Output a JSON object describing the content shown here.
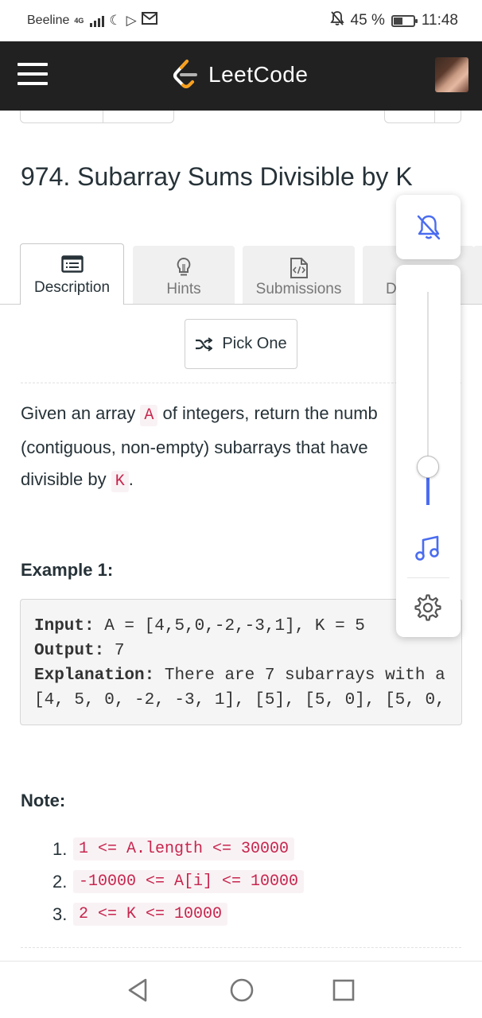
{
  "status_bar": {
    "carrier": "Beeline",
    "network": "4G",
    "battery_percent": "45 %",
    "battery_level": 0.45,
    "time": "11:48"
  },
  "header": {
    "logo_text": "LeetCode",
    "menu_icon": "hamburger-menu-icon"
  },
  "problem": {
    "title": "974. Subarray Sums Divisible by K"
  },
  "tabs": [
    {
      "label": "Description",
      "icon": "description-icon",
      "active": true
    },
    {
      "label": "Hints",
      "icon": "lightbulb-icon",
      "active": false
    },
    {
      "label": "Submissions",
      "icon": "code-file-icon",
      "active": false
    },
    {
      "label": "D",
      "icon": "discuss-icon",
      "active": false
    }
  ],
  "pick_one": {
    "label": "Pick One",
    "icon": "shuffle-icon"
  },
  "description": {
    "p1": "Given an array ",
    "code_a": "A",
    "p2": " of integers, return the numb",
    "line2": "(contiguous, non-empty) subarrays that have",
    "p3": "divisible by ",
    "code_k": "K",
    "p4": "."
  },
  "example": {
    "title": "Example 1:",
    "input_label": "Input:",
    "input_value": " A = [4,5,0,-2,-3,1], K = 5",
    "output_label": "Output:",
    "output_value": " 7",
    "explanation_label": "Explanation:",
    "explanation_value": " There are 7 subarrays with a",
    "explanation_line2": "[4, 5, 0, -2, -3, 1], [5], [5, 0], [5, 0,"
  },
  "note": {
    "title": "Note:",
    "items": [
      {
        "num": "1.",
        "code": "1 <= A.length <= 30000"
      },
      {
        "num": "2.",
        "code": "-10000 <= A[i] <= 10000"
      },
      {
        "num": "3.",
        "code": "2 <= K <= 10000"
      }
    ]
  },
  "volume_overlay": {
    "mute_icon": "bell-off-icon",
    "level": 0.18,
    "music_icon": "music-note-icon",
    "settings_icon": "gear-icon",
    "accent": "#4a6cf0"
  },
  "nav_bar": {
    "back_icon": "back-triangle-icon",
    "home_icon": "home-circle-icon",
    "recents_icon": "recents-square-icon"
  }
}
